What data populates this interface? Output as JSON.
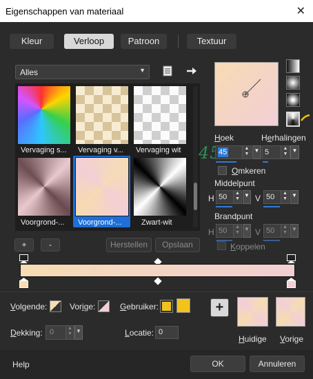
{
  "window": {
    "title": "Eigenschappen van materiaal",
    "close_glyph": "✕"
  },
  "tabs": [
    {
      "label": "Kleur",
      "active": false
    },
    {
      "label": "Verloop",
      "active": true
    },
    {
      "label": "Patroon",
      "active": false
    },
    {
      "label": "Textuur",
      "active": false
    }
  ],
  "category": {
    "selected": "Alles"
  },
  "presets": [
    {
      "label": "Vervaging s...",
      "selected": false
    },
    {
      "label": "Vervaging v...",
      "selected": false
    },
    {
      "label": "Vervaging wit",
      "selected": false
    },
    {
      "label": "Voorgrond-...",
      "selected": false
    },
    {
      "label": "Voorgrond-...",
      "selected": true
    },
    {
      "label": "Zwart-wit",
      "selected": false
    }
  ],
  "preset_buttons": {
    "add": "+",
    "remove": "-",
    "reset": "Herstellen",
    "save": "Opslaan"
  },
  "angle": {
    "label": "Hoek",
    "value": "45",
    "overlay": "45"
  },
  "repeats": {
    "label": "Herhalingen",
    "value": "5",
    "overlay": "5"
  },
  "invert": {
    "label": "Omkeren"
  },
  "midpoint": {
    "label": "Middelpunt",
    "h_label": "H",
    "h_value": "50",
    "v_label": "V",
    "v_value": "50"
  },
  "focal": {
    "label": "Brandpunt",
    "h_label": "H",
    "h_value": "50",
    "v_label": "V",
    "v_value": "50"
  },
  "link": {
    "label": "Koppelen"
  },
  "stops": {
    "next_label": "Volgende:",
    "prev_label": "Vorige:",
    "user_label": "Gebruiker:",
    "opacity_label": "Dekking:",
    "opacity_value": "0",
    "location_label": "Locatie:",
    "location_value": "0"
  },
  "preview": {
    "current_label": "Huidige",
    "previous_label": "Vorige",
    "plus": "+"
  },
  "footer": {
    "help": "Help",
    "ok": "OK",
    "cancel": "Annuleren"
  },
  "colors": {
    "gradient_start": "#f6dcb4",
    "gradient_end": "#f3cfd6",
    "user_swatch": "#f2c31c",
    "selection": "#1e6fd9"
  }
}
